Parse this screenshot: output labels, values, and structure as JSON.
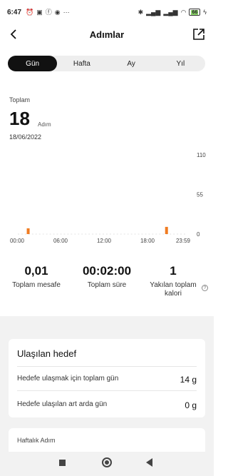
{
  "status_bar": {
    "time": "6:47",
    "left_icons": [
      "alarm-icon",
      "app-notification-icon",
      "facebook-icon",
      "app-icon"
    ],
    "more": "···",
    "right_icons": [
      "bluetooth-icon",
      "signal-icon",
      "signal-icon",
      "wifi-icon"
    ],
    "battery": "66"
  },
  "header": {
    "title": "Adımlar"
  },
  "tabs": [
    {
      "label": "Gün",
      "active": true
    },
    {
      "label": "Hafta",
      "active": false
    },
    {
      "label": "Ay",
      "active": false
    },
    {
      "label": "Yıl",
      "active": false
    }
  ],
  "summary": {
    "label": "Toplam",
    "value": "18",
    "unit": "Adım",
    "date": "18/06/2022"
  },
  "chart_data": {
    "type": "bar",
    "x_ticks": [
      "00:00",
      "06:00",
      "12:00",
      "18:00",
      "23:59"
    ],
    "y_ticks": [
      "110",
      "55",
      "0"
    ],
    "ylim": [
      0,
      110
    ],
    "bar_color": "#f07c22",
    "bars": [
      {
        "hour": 1,
        "value": 8
      },
      {
        "hour": 21,
        "value": 10
      }
    ]
  },
  "stats": [
    {
      "value": "0,01",
      "label": "Toplam mesafe"
    },
    {
      "value": "00:02:00",
      "label": "Toplam süre"
    },
    {
      "value": "1",
      "label": "Yakılan toplam kalori"
    }
  ],
  "goal_card": {
    "title": "Ulaşılan hedef",
    "rows": [
      {
        "label": "Hedefe ulaşmak için toplam gün",
        "value": "14 g"
      },
      {
        "label": "Hedefe ulaşılan art arda gün",
        "value": "0 g"
      }
    ]
  },
  "weekly_card": {
    "title": "Haftalık Adım"
  },
  "colors": {
    "accent": "#f07c22",
    "tab_active_bg": "#111111"
  }
}
